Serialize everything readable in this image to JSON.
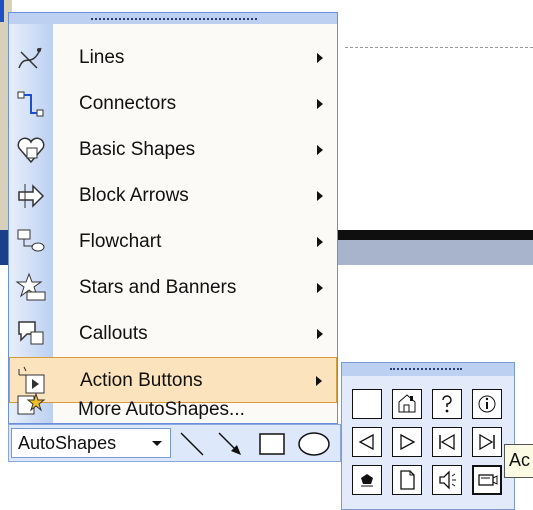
{
  "menu": {
    "items": [
      {
        "label": "Lines",
        "icon": "lines-icon"
      },
      {
        "label": "Connectors",
        "icon": "connectors-icon"
      },
      {
        "label": "Basic Shapes",
        "icon": "basic-shapes-icon"
      },
      {
        "label": "Block Arrows",
        "icon": "block-arrows-icon"
      },
      {
        "label": "Flowchart",
        "icon": "flowchart-icon"
      },
      {
        "label": "Stars and Banners",
        "icon": "stars-banners-icon"
      },
      {
        "label": "Callouts",
        "icon": "callouts-icon"
      },
      {
        "label": "Action Buttons",
        "icon": "action-buttons-icon"
      },
      {
        "label": "More AutoShapes...",
        "icon": "more-autoshapes-icon"
      }
    ],
    "highlighted": "Action Buttons"
  },
  "toolbar": {
    "autoshapes_label": "AutoShapes",
    "tools": [
      "line-icon",
      "arrow-icon",
      "rectangle-icon",
      "oval-icon"
    ]
  },
  "palette": {
    "buttons": [
      "custom",
      "home",
      "help",
      "information",
      "back",
      "forward",
      "beginning",
      "end",
      "return",
      "document",
      "sound",
      "movie"
    ]
  },
  "tooltip": {
    "text": "Ac"
  },
  "colors": {
    "highlight": "#fbe3bd",
    "highlight_border": "#d89b3b",
    "toolbar": "#dde8fa",
    "icon_column": "#bcd0f2"
  }
}
